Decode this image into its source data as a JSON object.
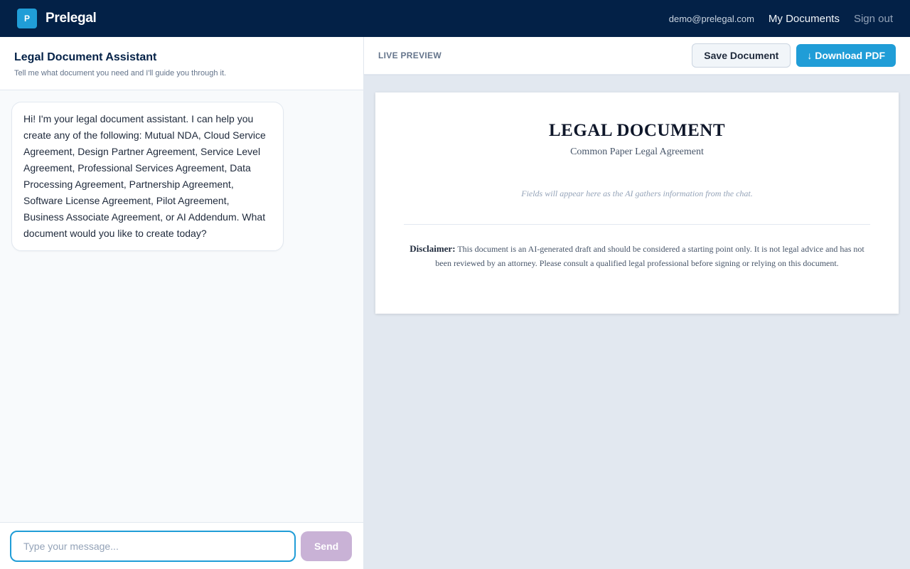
{
  "header": {
    "logo_letter": "P",
    "brand": "Prelegal",
    "user_email": "demo@prelegal.com",
    "nav": {
      "my_documents": "My Documents",
      "sign_out": "Sign out"
    }
  },
  "chat": {
    "title": "Legal Document Assistant",
    "subtitle": "Tell me what document you need and I'll guide you through it.",
    "messages": [
      {
        "role": "assistant",
        "text": "Hi! I'm your legal document assistant. I can help you create any of the following: Mutual NDA, Cloud Service Agreement, Design Partner Agreement, Service Level Agreement, Professional Services Agreement, Data Processing Agreement, Partnership Agreement, Software License Agreement, Pilot Agreement, Business Associate Agreement, or AI Addendum. What document would you like to create today?"
      }
    ],
    "input_placeholder": "Type your message...",
    "input_value": "",
    "send_label": "Send"
  },
  "preview": {
    "label": "LIVE PREVIEW",
    "save_label": "Save Document",
    "download_label": "↓ Download PDF",
    "document": {
      "title": "LEGAL DOCUMENT",
      "subtitle": "Common Paper Legal Agreement",
      "placeholder": "Fields will appear here as the AI gathers information from the chat.",
      "disclaimer_label": "Disclaimer:",
      "disclaimer_text": "This document is an AI-generated draft and should be considered a starting point only. It is not legal advice and has not been reviewed by an attorney. Please consult a qualified legal professional before signing or relying on this document."
    }
  },
  "colors": {
    "navy": "#032147",
    "accent_blue": "#209dd7",
    "send_purple": "#c9b2d6",
    "panel_gray": "#e2e8f0"
  }
}
